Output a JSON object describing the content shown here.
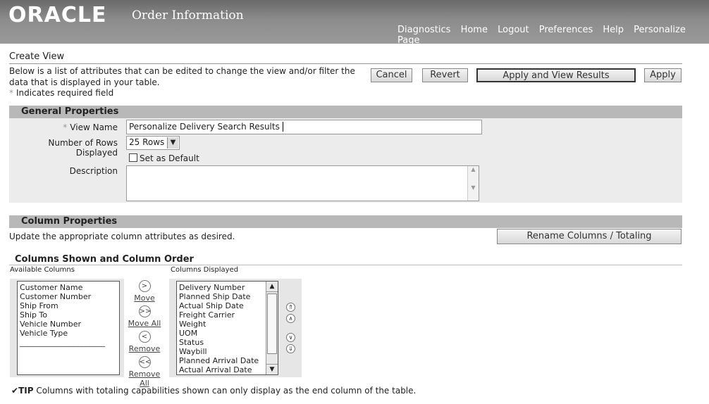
{
  "header": {
    "logo": "ORACLE",
    "app_title": "Order Information",
    "links": [
      "Diagnostics",
      "Home",
      "Logout",
      "Preferences",
      "Help",
      "Personalize Page"
    ]
  },
  "page": {
    "title": "Create View",
    "intro": "Below is a list of attributes that can be edited to change the view and/or filter the data that is displayed in your table.",
    "required_note": "Indicates required field",
    "required_marker": "*"
  },
  "buttons": {
    "cancel": "Cancel",
    "revert": "Revert",
    "apply_view": "Apply and View Results",
    "apply": "Apply"
  },
  "general": {
    "header": "General Properties",
    "view_name_label": "View Name",
    "view_name_value": "Personalize Delivery Search Results",
    "rows_label": "Number of Rows Displayed",
    "rows_value": "25 Rows",
    "default_label": "Set as Default",
    "description_label": "Description",
    "description_value": ""
  },
  "column_props": {
    "header": "Column Properties",
    "instructions": "Update the appropriate column attributes as desired.",
    "rename_button": "Rename Columns / Totaling"
  },
  "shuttle": {
    "header": "Columns Shown and Column Order",
    "available_label": "Available Columns",
    "displayed_label": "Columns Displayed",
    "available": [
      "Customer Name",
      "Customer Number",
      "Ship From",
      "Ship To",
      "Vehicle Number",
      "Vehicle Type",
      "______________________"
    ],
    "displayed": [
      "Delivery Number",
      "Planned Ship Date",
      "Actual Ship Date",
      "Freight Carrier",
      "Weight",
      "UOM",
      "Status",
      "Waybill",
      "Planned Arrival Date",
      "Actual Arrival Date"
    ],
    "move": "Move",
    "move_all": "Move All",
    "remove": "Remove",
    "remove_all": "Remove All"
  },
  "tip": {
    "label": "TIP",
    "text": "Columns with totaling capabilities shown can only display as the end column of the table."
  },
  "colors": {
    "header_bg": "#8c8c8c",
    "section_bg": "#b8b8b8",
    "panel_bg": "#ececec"
  }
}
